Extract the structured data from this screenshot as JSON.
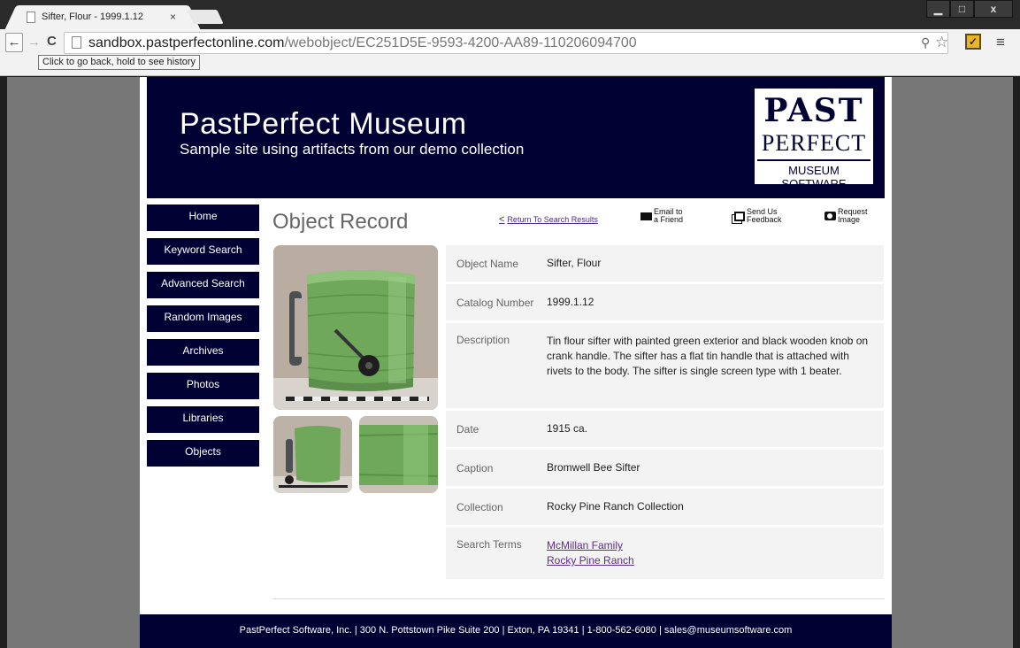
{
  "browser": {
    "tab_title": "Sifter, Flour - 1999.1.12",
    "tab_close": "×",
    "url_host": "sandbox.pastperfectonline.com",
    "url_path": "/webobject/EC251D5E-9593-4200-AA89-110206094700",
    "back_tooltip": "Click to go back, hold to see history",
    "window_buttons": {
      "minimize": "▁",
      "maximize": "□",
      "close": "x"
    },
    "icons": {
      "back": "arrow-left-icon",
      "forward": "arrow-right-icon",
      "reload": "reload-icon",
      "star": "star-icon",
      "menu": "hamburger-menu-icon"
    }
  },
  "site": {
    "title": "PastPerfect Museum",
    "subtitle": "Sample site using artifacts from our demo collection",
    "logo": {
      "line1": "PAST",
      "line2": "PERFECT",
      "line3": "MUSEUM SOFTWARE"
    },
    "colors": {
      "navy": "#000033",
      "link": "#5b2e8c",
      "label": "#666666",
      "row_bg": "#f3f3f3"
    }
  },
  "nav": {
    "items": [
      "Home",
      "Keyword Search",
      "Advanced Search",
      "Random Images",
      "Archives",
      "Photos",
      "Libraries",
      "Objects"
    ]
  },
  "record": {
    "heading": "Object Record",
    "return_caret": "<",
    "return_link": "Return To Search Results",
    "actions": [
      {
        "line1": "Email to",
        "line2": "a Friend",
        "icon": "envelope-icon"
      },
      {
        "line1": "Send Us",
        "line2": "Feedback",
        "icon": "feedback-icon"
      },
      {
        "line1": "Request",
        "line2": "Image",
        "icon": "camera-icon"
      }
    ],
    "fields": [
      {
        "label": "Object Name",
        "value": "Sifter, Flour"
      },
      {
        "label": "Catalog Number",
        "value": "1999.1.12"
      },
      {
        "label": "Description",
        "value": "Tin flour sifter with painted green exterior and black wooden knob on crank handle. The sifter has a flat tin handle that is attached with rivets to the body. The sifter is single screen type with 1 beater."
      },
      {
        "label": "Date",
        "value": "1915 ca."
      },
      {
        "label": "Caption",
        "value": "Bromwell Bee Sifter"
      },
      {
        "label": "Collection",
        "value": "Rocky Pine Ranch Collection"
      }
    ],
    "search_terms_label": "Search Terms",
    "search_terms": [
      "McMillan Family",
      "Rocky Pine Ranch"
    ]
  },
  "footer": {
    "text": "PastPerfect Software, Inc. | 300 N. Pottstown Pike Suite 200 | Exton, PA 19341 | 1-800-562-6080 | sales@museumsoftware.com"
  }
}
